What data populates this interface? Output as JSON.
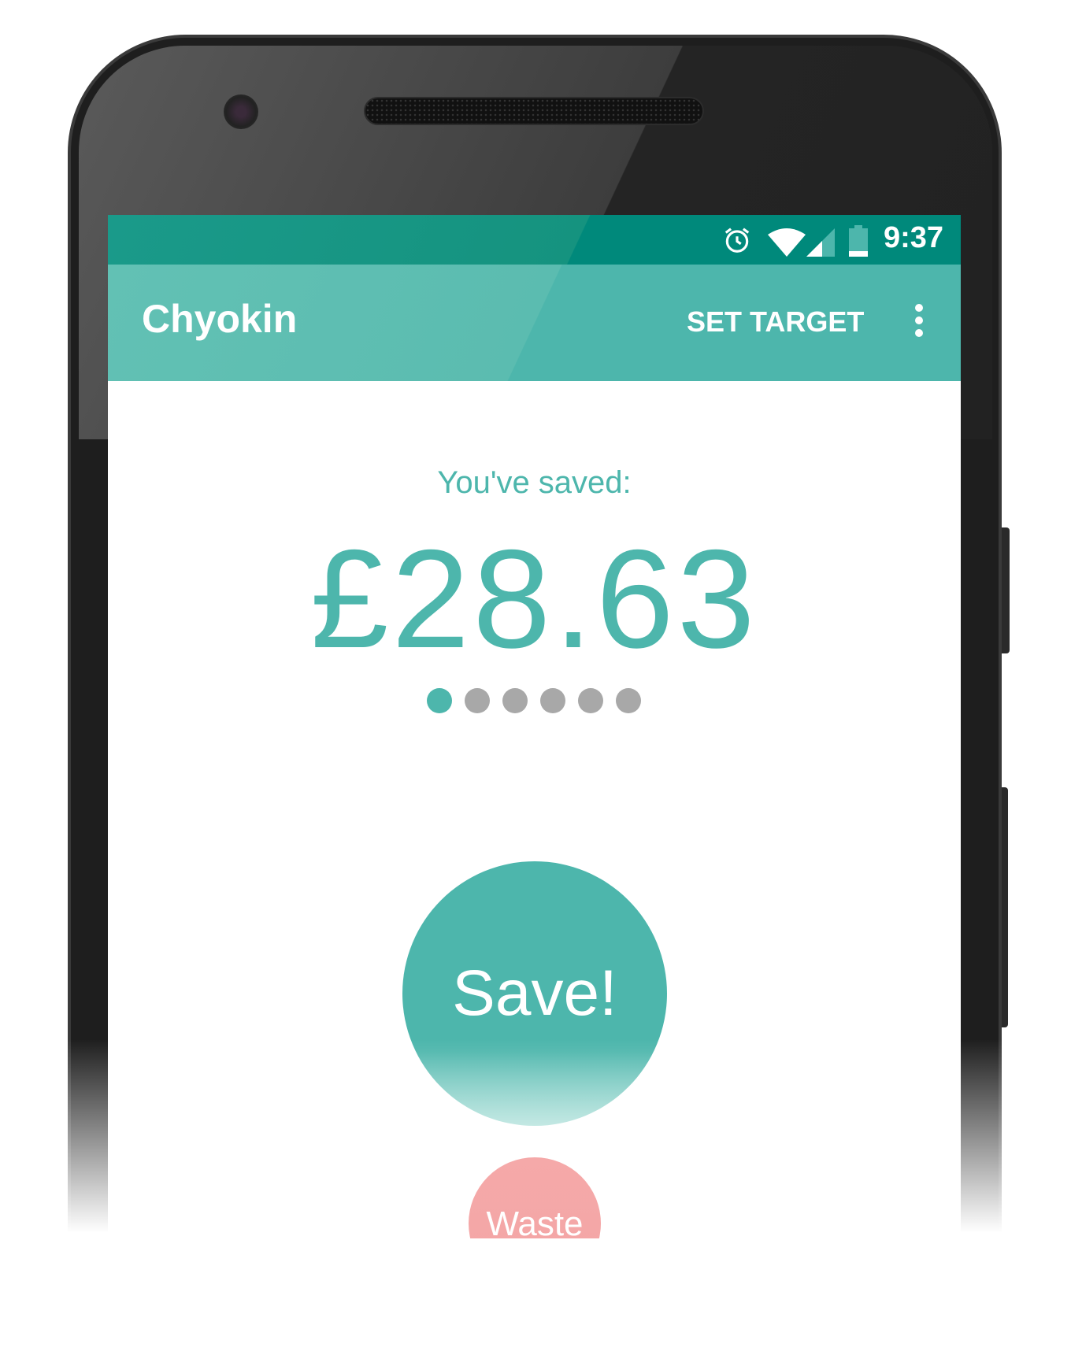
{
  "status_bar": {
    "time": "9:37",
    "icons": [
      "alarm-icon",
      "wifi-icon",
      "cell-signal-icon",
      "battery-icon"
    ]
  },
  "app_bar": {
    "title": "Chyokin",
    "action_label": "SET TARGET",
    "menu_icon": "more-vert-icon"
  },
  "main": {
    "saved_label": "You've saved:",
    "amount": "£28.63",
    "page_indicator": {
      "count": 6,
      "active_index": 0
    },
    "save_button": "Save!",
    "waste_button": "Waste"
  },
  "colors": {
    "primary": "#4db6ac",
    "primary_dark": "#00897b",
    "waste": "#f8b9b9",
    "indicator_inactive": "#a8a8a8"
  }
}
